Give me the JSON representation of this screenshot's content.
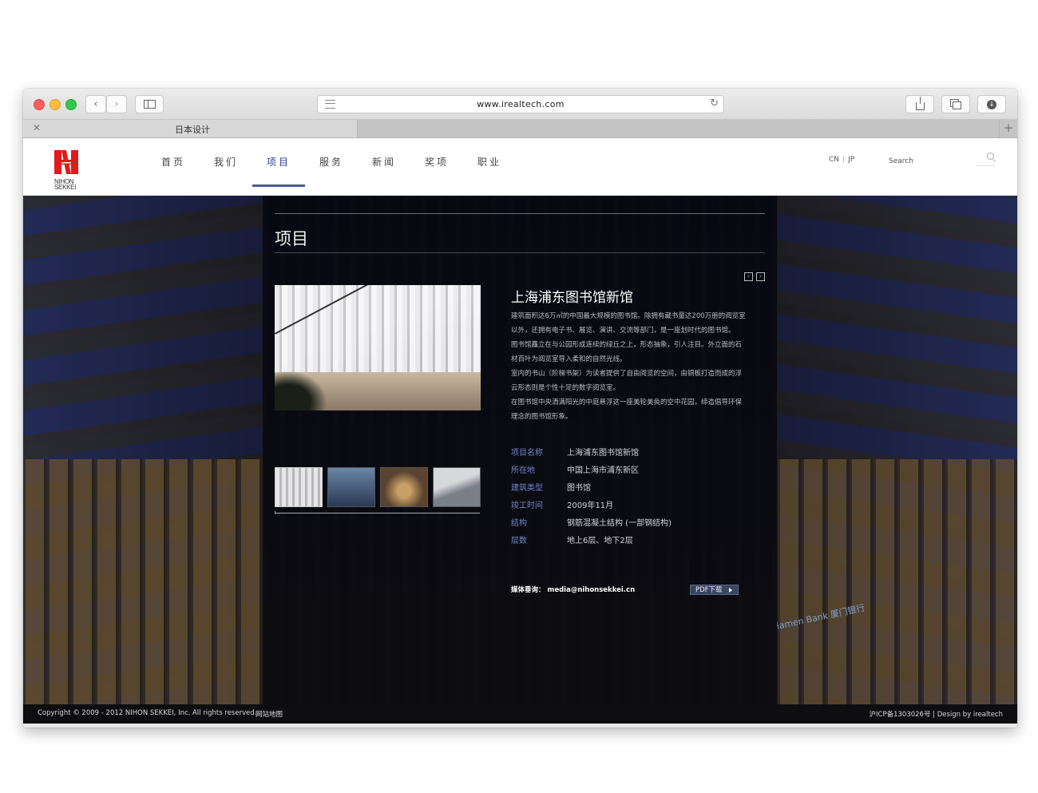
{
  "browser": {
    "url": "www.irealtech.com",
    "tab_title": "日本设计",
    "tab_new": "+",
    "tab_close": "✕",
    "back": "‹",
    "forward": "›",
    "reload": "↻"
  },
  "site": {
    "logo_text": [
      "NIHON",
      "SEKKEI"
    ],
    "logo_color": "#e3191b",
    "nav": [
      {
        "label": "首页"
      },
      {
        "label": "我们"
      },
      {
        "label": "项目"
      },
      {
        "label": "服务"
      },
      {
        "label": "新闻"
      },
      {
        "label": "奖项"
      },
      {
        "label": "职业"
      }
    ],
    "active_nav": "项目",
    "lang_cn": "CN",
    "lang_sep": "|",
    "lang_jp": "JP",
    "search_placeholder": "Search"
  },
  "project": {
    "section_title": "项目",
    "title": "上海浦东图书馆新馆",
    "description": [
      "建筑面积达6万㎡的中国最大规模的图书馆。除拥有藏书量达200万册的阅览室以外，还拥有电子书、展览、演讲、交流等部门，是一座划时代的图书馆。",
      "图书馆矗立在与公园形成连续的绿丘之上，形态抽象，引人注目。外立面的石材百叶为阅览室导入柔和的自然光线。",
      "室内的书山（阶梯书架）为读者提供了自由阅览的空间，由铜板打造而成的浮云形态则是个性十足的数字阅览室。",
      "在图书馆中央洒满阳光的中庭悬浮这一座美轮美奂的空中花园，缔造倡导环保理念的图书馆形象。"
    ],
    "specs": [
      {
        "label": "项目名称",
        "value": "上海浦东图书馆新馆"
      },
      {
        "label": "所在地",
        "value": "中国上海市浦东新区"
      },
      {
        "label": "建筑类型",
        "value": "图书馆"
      },
      {
        "label": "竣工时间",
        "value": "2009年11月"
      },
      {
        "label": "结构",
        "value": "钢筋混凝土结构 (一部钢结构)"
      },
      {
        "label": "层数",
        "value": "地上6层、地下2层"
      }
    ],
    "media_contact": "媒体垂询： media@nihonsekkei.cn",
    "pdf_label": "PDF下载",
    "prev_arrow": "‹",
    "next_arrow": "›",
    "bank_sign": "Xiamen Bank 厦门银行"
  },
  "footer": {
    "copyright": "Copyright © 2009 - 2012 NIHON SEKKEI, Inc. All rights reserved.",
    "sitemap": "网站地图",
    "icp": "沪ICP备1303026号 | Design by irealtech"
  }
}
